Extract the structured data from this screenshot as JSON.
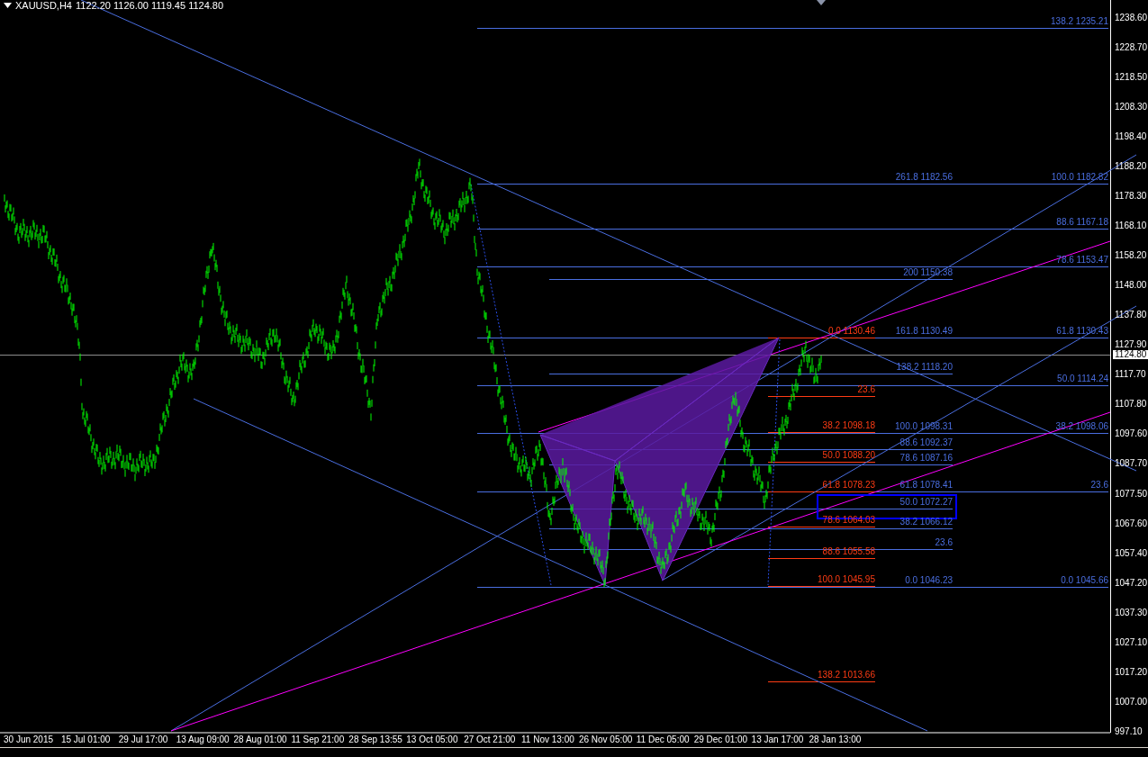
{
  "chart": {
    "symbol": "XAUUSD,H4",
    "ohlc": "1122.20 1126.00 1119.45 1124.80"
  },
  "price_axis": [
    "1238.60",
    "1228.70",
    "1218.50",
    "1208.30",
    "1198.40",
    "1188.20",
    "1178.30",
    "1168.10",
    "1158.20",
    "1148.00",
    "1137.80",
    "1127.90",
    "1117.70",
    "1107.80",
    "1097.60",
    "1087.70",
    "1077.50",
    "1067.60",
    "1057.40",
    "1047.20",
    "1037.30",
    "1027.10",
    "1017.20",
    "1007.00",
    "997.10"
  ],
  "current_price": "1124.80",
  "time_axis": [
    "30 Jun 2015",
    "15 Jul 01:00",
    "29 Jul 17:00",
    "13 Aug 09:00",
    "28 Aug 01:00",
    "11 Sep 21:00",
    "28 Sep 13:55",
    "13 Oct 05:00",
    "27 Oct 21:00",
    "11 Nov 13:00",
    "26 Nov 05:00",
    "11 Dec 05:00",
    "29 Dec 01:00",
    "13 Jan 17:00",
    "28 Jan 13:00"
  ],
  "fib_levels": [
    {
      "text": "138.2 1235.21",
      "color": "#4a6ee0"
    },
    {
      "text": "100.0 1182.82",
      "color": "#4a6ee0"
    },
    {
      "text": "88.6 1167.18",
      "color": "#4a6ee0"
    },
    {
      "text": "78.6 1153.47",
      "color": "#4a6ee0"
    },
    {
      "text": "61.8 1130.43",
      "color": "#4a6ee0"
    },
    {
      "text": "50.0 1114.24",
      "color": "#4a6ee0"
    },
    {
      "text": "38.2 1098.06",
      "color": "#4a6ee0"
    },
    {
      "text": "23.6",
      "color": "#4a6ee0"
    },
    {
      "text": "0.0 1045.66",
      "color": "#4a6ee0"
    },
    {
      "text": "261.8 1182.56",
      "color": "#4a6ee0"
    },
    {
      "text": "200 1150.38",
      "color": "#4a6ee0"
    },
    {
      "text": "161.8 1130.49",
      "color": "#4a6ee0"
    },
    {
      "text": "138.2 1118.20",
      "color": "#4a6ee0"
    },
    {
      "text": "100.0 1098.31",
      "color": "#4a6ee0"
    },
    {
      "text": "88.6 1092.37",
      "color": "#4a6ee0"
    },
    {
      "text": "78.6 1087.16",
      "color": "#4a6ee0"
    },
    {
      "text": "61.8 1078.41",
      "color": "#4a6ee0"
    },
    {
      "text": "50.0 1072.27",
      "color": "#4a6ee0"
    },
    {
      "text": "38.2 1066.12",
      "color": "#4a6ee0"
    },
    {
      "text": "23.6",
      "color": "#4a6ee0"
    },
    {
      "text": "0.0 1046.23",
      "color": "#4a6ee0"
    },
    {
      "text": "0.0 1130.46",
      "color": "#ff3c14"
    },
    {
      "text": "23.6",
      "color": "#ff3c14"
    },
    {
      "text": "38.2 1098.18",
      "color": "#ff3c14"
    },
    {
      "text": "50.0 1088.20",
      "color": "#ff3c14"
    },
    {
      "text": "61.8 1078.23",
      "color": "#ff3c14"
    },
    {
      "text": "78.6 1064.03",
      "color": "#ff3c14"
    },
    {
      "text": "88.6 1055.58",
      "color": "#ff3c14"
    },
    {
      "text": "100.0 1045.95",
      "color": "#ff3c14"
    },
    {
      "text": "138.2 1013.66",
      "color": "#ff3c14"
    }
  ]
}
